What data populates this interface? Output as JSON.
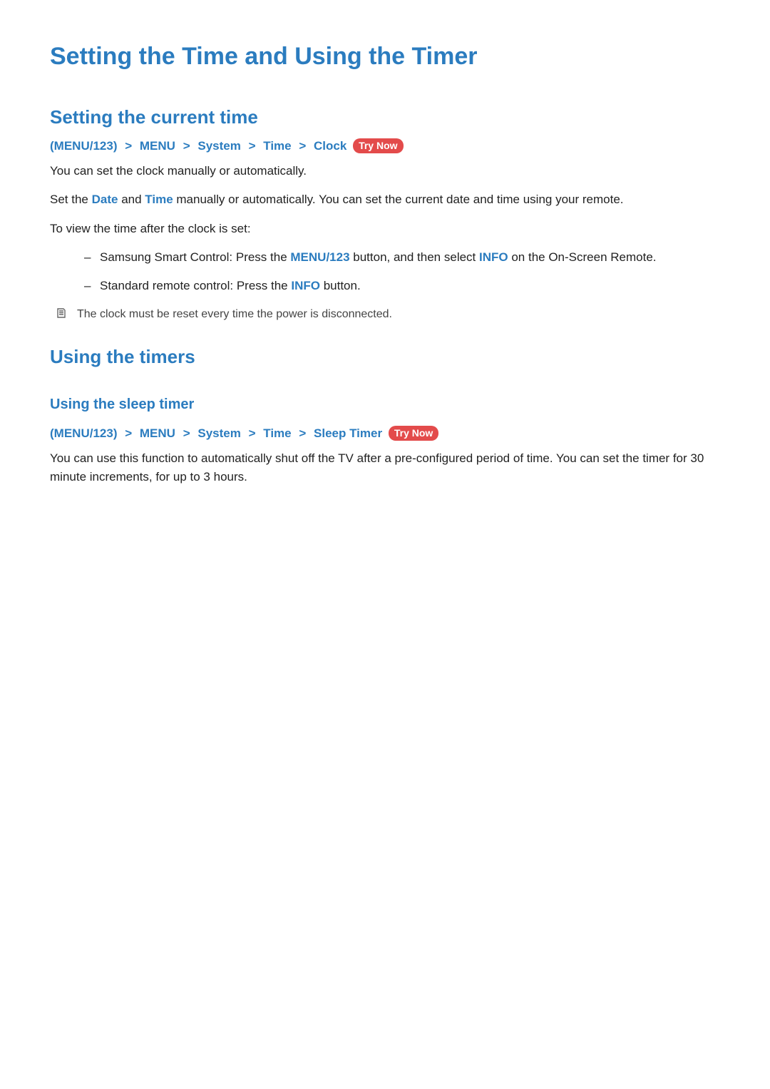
{
  "title": "Setting the Time and Using the Timer",
  "section1": {
    "heading": "Setting the current time",
    "crumb": {
      "root": "MENU/123",
      "a": "MENU",
      "b": "System",
      "c": "Time",
      "d": "Clock"
    },
    "try_now": "Try Now",
    "p1": "You can set the clock manually or automatically.",
    "p2a": "Set the ",
    "p2_date": "Date",
    "p2b": " and ",
    "p2_time": "Time",
    "p2c": " manually or automatically. You can set the current date and time using your remote.",
    "p3": "To view the time after the clock is set:",
    "li1a": "Samsung Smart Control: Press the ",
    "li1_kw": "MENU/123",
    "li1b": " button, and then select ",
    "li1_kw2": "INFO",
    "li1c": " on the On-Screen Remote.",
    "li2a": "Standard remote control: Press the ",
    "li2_kw": "INFO",
    "li2b": " button.",
    "note": "The clock must be reset every time the power is disconnected."
  },
  "section2": {
    "heading": "Using the timers",
    "sub": "Using the sleep timer",
    "crumb": {
      "root": "MENU/123",
      "a": "MENU",
      "b": "System",
      "c": "Time",
      "d": "Sleep Timer"
    },
    "try_now": "Try Now",
    "p1": "You can use this function to automatically shut off the TV after a pre-configured period of time. You can set the timer for 30 minute increments, for up to 3 hours."
  }
}
